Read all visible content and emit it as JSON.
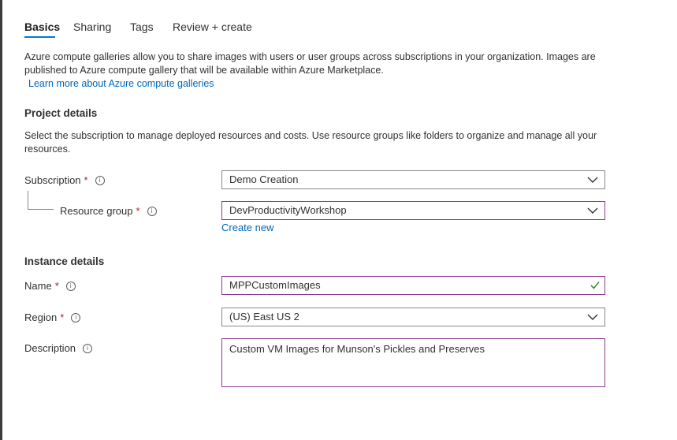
{
  "tabs": [
    {
      "label": "Basics",
      "active": true
    },
    {
      "label": "Sharing",
      "active": false
    },
    {
      "label": "Tags",
      "active": false
    },
    {
      "label": "Review + create",
      "active": false
    }
  ],
  "intro": {
    "text": "Azure compute galleries allow you to share images with users or user groups across subscriptions in your organization. Images are published to Azure compute gallery that will be available within Azure Marketplace.",
    "link": "Learn more about Azure compute galleries"
  },
  "project": {
    "title": "Project details",
    "description": "Select the subscription to manage deployed resources and costs. Use resource groups like folders to organize and manage all your resources.",
    "subscription": {
      "label": "Subscription",
      "required": "*",
      "value": "Demo Creation"
    },
    "resource_group": {
      "label": "Resource group",
      "required": "*",
      "value": "DevProductivityWorkshop",
      "create_new": "Create new"
    }
  },
  "instance": {
    "title": "Instance details",
    "name": {
      "label": "Name",
      "required": "*",
      "value": "MPPCustomImages"
    },
    "region": {
      "label": "Region",
      "required": "*",
      "value": "(US) East US 2"
    },
    "description": {
      "label": "Description",
      "value": "Custom VM Images for Munson's Pickles and Preserves"
    }
  },
  "icons": {
    "info": "info-circle-icon",
    "dropdown": "chevron-down-icon",
    "valid": "checkmark-icon"
  },
  "colors": {
    "accent": "#0078d4",
    "link": "#0067b8",
    "required": "#a4262c",
    "focus_border": "#8a3a8f",
    "valid": "#107c10"
  }
}
